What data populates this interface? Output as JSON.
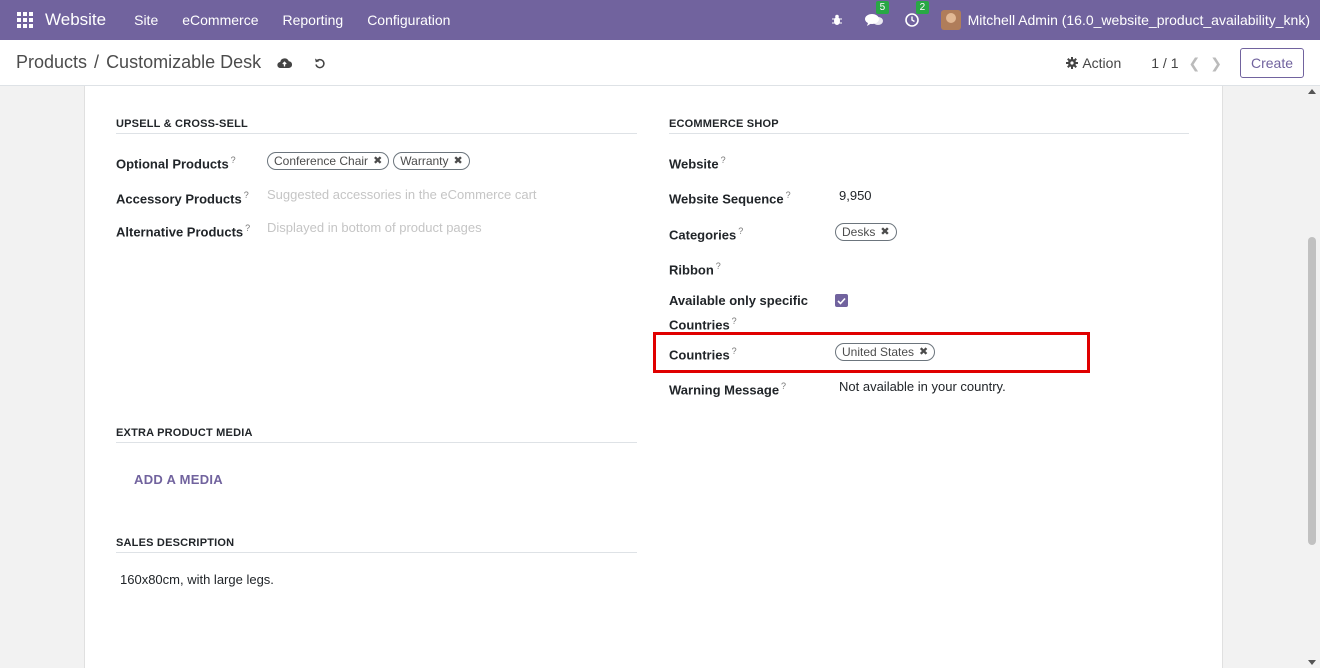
{
  "navbar": {
    "brand": "Website",
    "menu": [
      "Site",
      "eCommerce",
      "Reporting",
      "Configuration"
    ],
    "messages_count": "5",
    "activities_count": "2",
    "user": "Mitchell Admin (16.0_website_product_availability_knk)",
    "accent": "#71639e"
  },
  "control": {
    "breadcrumb_parent": "Products",
    "breadcrumb_separator": "/",
    "breadcrumb_current": "Customizable Desk",
    "action_label": "Action",
    "pager": "1 / 1",
    "create_label": "Create"
  },
  "upsell": {
    "title": "UPSELL & CROSS-SELL",
    "optional_label": "Optional Products",
    "optional_tags": [
      "Conference Chair",
      "Warranty"
    ],
    "accessory_label": "Accessory Products",
    "accessory_placeholder": "Suggested accessories in the eCommerce cart",
    "alternative_label": "Alternative Products",
    "alternative_placeholder": "Displayed in bottom of product pages"
  },
  "ecommerce": {
    "title": "ECOMMERCE SHOP",
    "website_label": "Website",
    "sequence_label": "Website Sequence",
    "sequence_value": "9,950",
    "categories_label": "Categories",
    "categories_tags": [
      "Desks"
    ],
    "ribbon_label": "Ribbon",
    "available_label_1": "Available only specific",
    "available_label_2": "Countries",
    "available_checked": true,
    "countries_label": "Countries",
    "countries_tags": [
      "United States"
    ],
    "warning_label": "Warning Message",
    "warning_value": "Not available in your country."
  },
  "media": {
    "title": "EXTRA PRODUCT MEDIA",
    "add_label": "ADD A MEDIA"
  },
  "sales": {
    "title": "SALES DESCRIPTION",
    "text": "160x80cm, with large legs."
  },
  "highlight_color": "#e00000"
}
